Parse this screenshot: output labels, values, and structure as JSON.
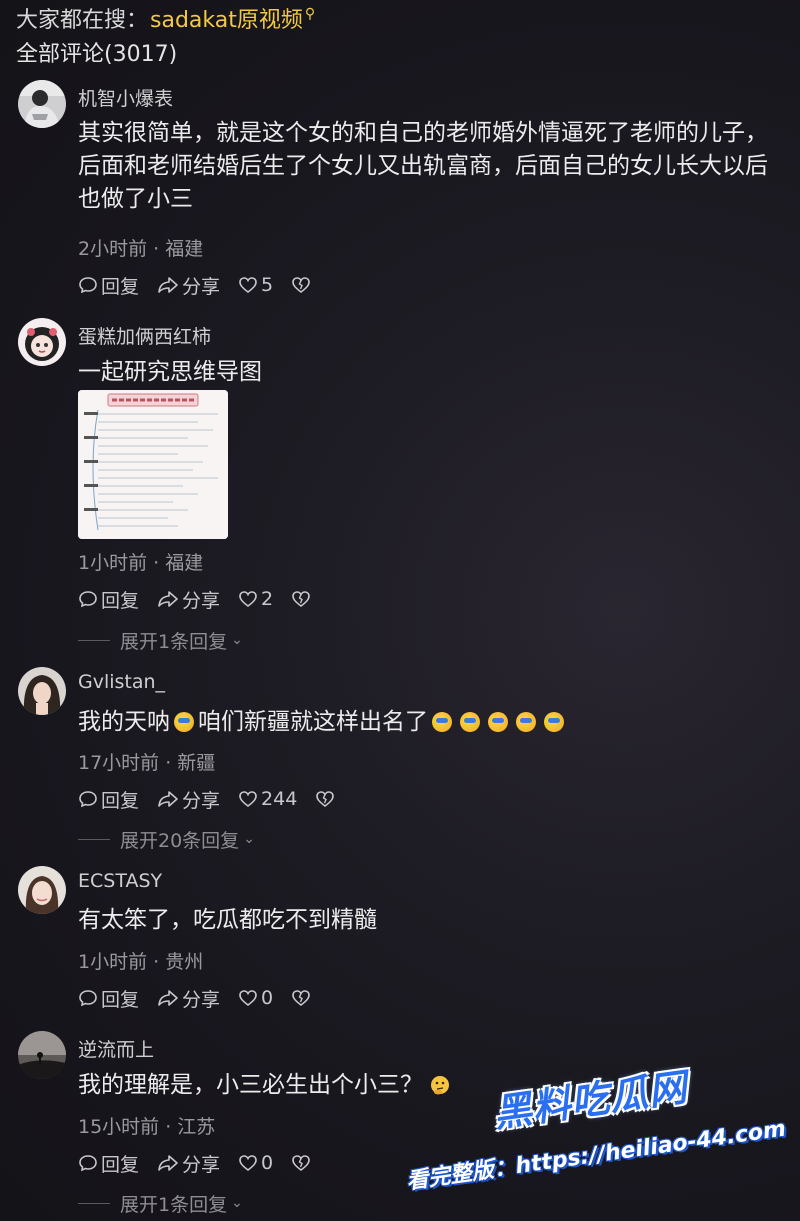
{
  "header": {
    "search_prefix": "大家都在搜：",
    "search_keyword": "sadakat原视频",
    "comment_count_label": "全部评论(3017)"
  },
  "comments": [
    {
      "username": "机智小爆表",
      "content": "其实很简单，就是这个女的和自己的老师婚外情逼死了老师的儿子，后面和老师结婚后生了个女儿又出轨富商，后面自己的女儿长大以后也做了小三",
      "meta": "2小时前 · 福建",
      "reply_label": "回复",
      "share_label": "分享",
      "likes": "5"
    },
    {
      "username": "蛋糕加俩西红柿",
      "content": "一起研究思维导图",
      "meta": "1小时前 · 福建",
      "reply_label": "回复",
      "share_label": "分享",
      "likes": "2",
      "expand_label": "展开1条回复"
    },
    {
      "username": "Gvlistan_",
      "content_a": "我的天呐",
      "content_b": "咱们新疆就这样出名了",
      "meta": "17小时前 · 新疆",
      "reply_label": "回复",
      "share_label": "分享",
      "likes": "244",
      "expand_label": "展开20条回复"
    },
    {
      "username": "ECSTASY",
      "content": "有太笨了，吃瓜都吃不到精髓",
      "meta": "1小时前 · 贵州",
      "reply_label": "回复",
      "share_label": "分享",
      "likes": "0"
    },
    {
      "username": "逆流而上",
      "content": "我的理解是，小三必生出个小三？",
      "meta": "15小时前 · 江苏",
      "reply_label": "回复",
      "share_label": "分享",
      "likes": "0",
      "expand_label": "展开1条回复"
    }
  ],
  "watermark": {
    "brand": "黑料吃瓜网",
    "url": "看完整版：https://heiliao-44.com"
  },
  "icons": {
    "search_keyword": "search-icon",
    "reply": "chat-bubble-icon",
    "share": "share-arrow-icon",
    "like": "heart-icon",
    "dislike": "broken-heart-icon",
    "emoji_laugh": "laugh-cry-emoji",
    "emoji_think": "thinking-emoji"
  },
  "colors": {
    "keyword": "#f2c846",
    "background": "#18161d",
    "watermark_blue": "#2a6ff0"
  }
}
